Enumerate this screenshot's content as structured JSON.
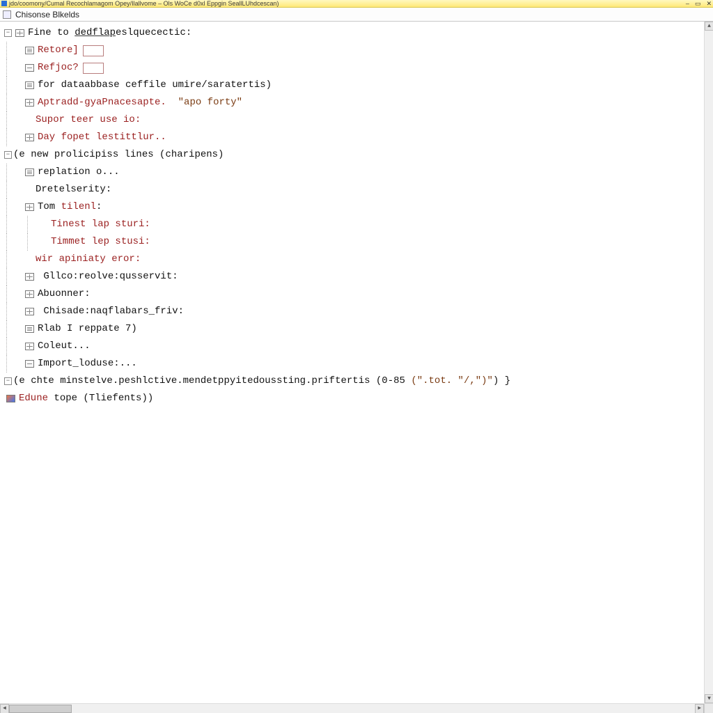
{
  "titlebar": {
    "text": "jdo/coomony/Cumal Recochlamagom Opey/Ilallvome – Ols WoCe d0xl Eppgin SeallLUhdcescan)"
  },
  "toolbar": {
    "label": "Chisonse Blkelds"
  },
  "tree": {
    "l0": {
      "pre": "Fine to ",
      "under": "dedflap",
      "post": "eslquecectic:"
    },
    "l1": {
      "label": "Retore]"
    },
    "l2": {
      "label": "Refjoc?"
    },
    "l3": {
      "text": "for dataabbase ceffile umire/saratertis)"
    },
    "l4": {
      "a": "Aptradd-gyaPnacesapte.",
      "b": "\"apo forty\""
    },
    "l5": {
      "text": "Supor teer use io:"
    },
    "l6": {
      "text": "Day fopet lestittlur.."
    },
    "l7": {
      "pre": "(e new ",
      "mid": "prolicipiss lines",
      "post": " (charipens)"
    },
    "l8": {
      "text": "replation o..."
    },
    "l9": {
      "text": "Dretelserity:"
    },
    "l10": {
      "a": "Tom ",
      "b": "tilenl",
      "c": ":"
    },
    "l11": {
      "text": "Tinest lap sturi:"
    },
    "l12": {
      "text": "Timmet lep stusi:"
    },
    "l13": {
      "text": "wir apiniaty eror:"
    },
    "l14": {
      "text": "Gllco:reolve:qusservit:"
    },
    "l15": {
      "text": "Abuonner:"
    },
    "l16": {
      "text": "Chisade:naqflabars_friv:"
    },
    "l17": {
      "text": "Rlab I reppate 7)"
    },
    "l18": {
      "text": "Coleut..."
    },
    "l19": {
      "text": "Import_loduse:..."
    },
    "l20": {
      "pre": "(e chte ",
      "mid": "minstelve.peshlctive.mendetppyitedoussting.priftertis",
      "num": "(0-85 ",
      "str": "(\".tot. \"/,\")\"",
      "post": ") }"
    },
    "l21": {
      "a": "Edune",
      "b": " tope (Tliefents))"
    }
  }
}
